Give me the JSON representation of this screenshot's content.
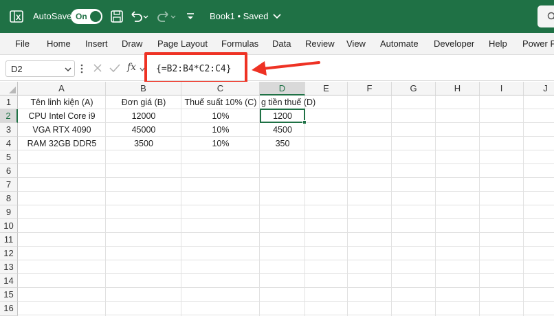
{
  "titlebar": {
    "autosave_label": "AutoSave",
    "toggle_state": "On",
    "doc_title": "Book1 • Saved",
    "colors": {
      "bar": "#1f7145"
    }
  },
  "ribbon": {
    "tabs": [
      "File",
      "Home",
      "Insert",
      "Draw",
      "Page Layout",
      "Formulas",
      "Data",
      "Review",
      "View",
      "Automate",
      "Developer",
      "Help",
      "Power P"
    ]
  },
  "formula_bar": {
    "name_box": "D2",
    "fx_label": "fx",
    "formula": "{=B2:B4*C2:C4}",
    "highlight_color": "#ee3224"
  },
  "sheet": {
    "columns": [
      "A",
      "B",
      "C",
      "D",
      "E",
      "F",
      "G",
      "H",
      "I",
      "J"
    ],
    "rows": [
      "1",
      "2",
      "3",
      "4",
      "5",
      "6",
      "7",
      "8",
      "9",
      "10",
      "11",
      "12",
      "13",
      "14",
      "15",
      "16"
    ],
    "header_row": [
      "Tên linh kiện (A)",
      "Đơn giá (B)",
      "Thuế suất 10% (C)",
      "g tiền thuế (D)"
    ],
    "data": [
      [
        "CPU Intel Core i9",
        "12000",
        "10%",
        "1200"
      ],
      [
        "VGA RTX 4090",
        "45000",
        "10%",
        "4500"
      ],
      [
        "RAM 32GB DDR5",
        "3500",
        "10%",
        "350"
      ]
    ],
    "active_cell": "D2"
  }
}
